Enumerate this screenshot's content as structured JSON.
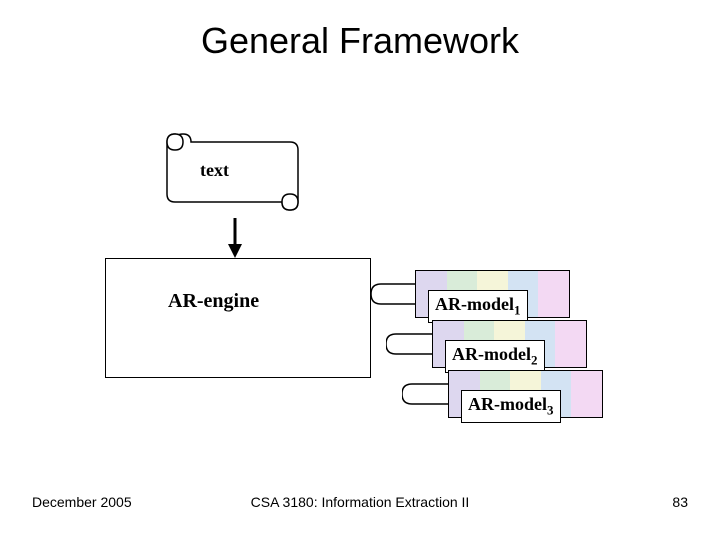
{
  "title": "General Framework",
  "scroll_label": "text",
  "engine_label": "AR-engine",
  "models": [
    {
      "label": "AR-model",
      "sub": "1"
    },
    {
      "label": "AR-model",
      "sub": "2"
    },
    {
      "label": "AR-model",
      "sub": "3"
    }
  ],
  "footer": {
    "left": "December 2005",
    "center": "CSA 3180: Information Extraction II",
    "right": "83"
  },
  "colors": {
    "stripe1": "#ddd7ef",
    "stripe2": "#d9ecd9",
    "stripe3": "#f5f5d9",
    "stripe4": "#d3e3f3",
    "stripe5": "#f3d9f3"
  }
}
